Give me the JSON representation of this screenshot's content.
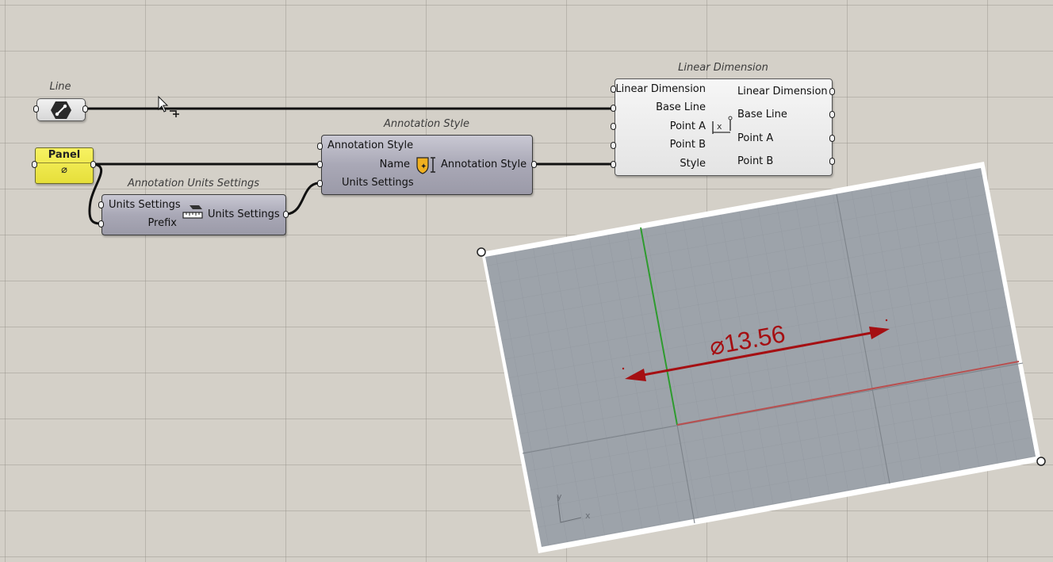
{
  "canvas": {
    "line_param": {
      "caption": "Line",
      "icon": "line-icon"
    },
    "panel": {
      "title": "Panel",
      "value": "⌀"
    },
    "units_settings": {
      "caption": "Annotation Units Settings",
      "inputs": [
        "Units Settings",
        "Prefix"
      ],
      "output": "Units Settings",
      "icon": "ruler-units-icon"
    },
    "annotation_style": {
      "caption": "Annotation Style",
      "inputs": [
        "Annotation Style",
        "Name",
        "Units Settings"
      ],
      "output": "Annotation Style",
      "icon": "annotation-style-icon"
    },
    "linear_dimension": {
      "caption": "Linear Dimension",
      "inputs": [
        "Linear Dimension",
        "Base Line",
        "Point A",
        "Point B",
        "Style"
      ],
      "outputs": [
        "Linear Dimension",
        "Base Line",
        "Point A",
        "Point B"
      ],
      "icon": "linear-dimension-icon"
    }
  },
  "viewport": {
    "dimension_text": "⌀13.56",
    "axis_x": "x",
    "axis_y": "y",
    "dimension_color": "#a50f12"
  },
  "colors": {
    "canvas_bg": "#d4d0c8",
    "component_fill": "#a9a8b6",
    "panel_fill": "#f0ea4a",
    "wire": "#111111"
  }
}
